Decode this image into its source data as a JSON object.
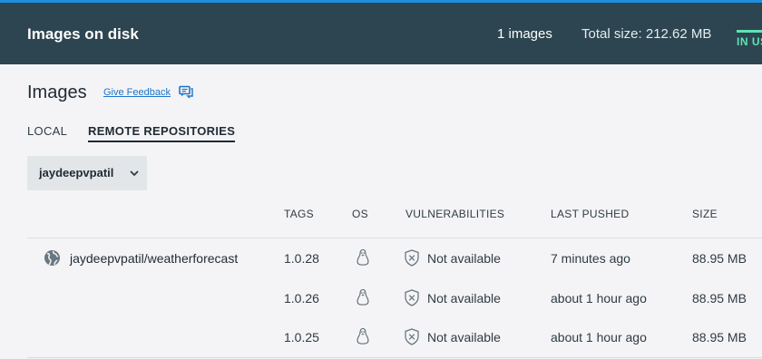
{
  "header": {
    "title": "Images on disk",
    "image_count": "1 images",
    "total_size": "Total size: 212.62 MB",
    "in_use_label": "IN USE"
  },
  "page": {
    "title": "Images",
    "feedback_link": "Give Feedback"
  },
  "tabs": [
    {
      "label": "LOCAL",
      "active": false
    },
    {
      "label": "REMOTE REPOSITORIES",
      "active": true
    }
  ],
  "repo_select": {
    "value": "jaydeepvpatil"
  },
  "table": {
    "columns": [
      "TAGS",
      "OS",
      "VULNERABILITIES",
      "LAST PUSHED",
      "SIZE"
    ],
    "repository": "jaydeepvpatil/weatherforecast",
    "rows": [
      {
        "tag": "1.0.28",
        "os": "linux",
        "vulnerabilities": "Not available",
        "last_pushed": "7 minutes ago",
        "size": "88.95 MB"
      },
      {
        "tag": "1.0.26",
        "os": "linux",
        "vulnerabilities": "Not available",
        "last_pushed": "about 1 hour ago",
        "size": "88.95 MB"
      },
      {
        "tag": "1.0.25",
        "os": "linux",
        "vulnerabilities": "Not available",
        "last_pushed": "about 1 hour ago",
        "size": "88.95 MB"
      }
    ]
  },
  "colors": {
    "header_bg": "#2d4550",
    "accent_blue": "#1d8fe1",
    "in_use_green": "#5ee3b3",
    "link_blue": "#1d74c9"
  },
  "icons": {
    "feedback": "feedback-icon",
    "chevron": "chevron-down-icon",
    "globe": "globe-icon",
    "os": "linux-icon",
    "vulnerability": "shield-x-icon"
  }
}
